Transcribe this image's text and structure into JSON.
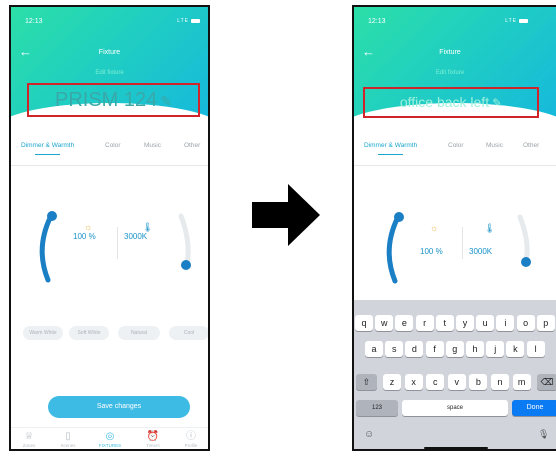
{
  "status": {
    "time": "12:13",
    "network": "LTE"
  },
  "header": {
    "title": "Fixture",
    "back": "←",
    "subtitle": "Edit fixture"
  },
  "before": {
    "name": "PRISM 124"
  },
  "after": {
    "name": "office back left"
  },
  "edit_icon": "✎",
  "tabs": [
    "Dimmer & Warmth",
    "Color",
    "Music",
    "Other"
  ],
  "dimmer": {
    "brightness": "100 %",
    "temperature": "3000K",
    "sun_icon": "☼",
    "therm_icon": "🌡"
  },
  "presets": [
    "Warm White",
    "Soft White",
    "Natural",
    "Cool"
  ],
  "save_label": "Save changes",
  "nav": [
    {
      "label": "Zones",
      "icon": "♕"
    },
    {
      "label": "Scenes",
      "icon": "▯"
    },
    {
      "label": "FIXTURES",
      "icon": "◎"
    },
    {
      "label": "Timers",
      "icon": "⏰"
    },
    {
      "label": "Profile",
      "icon": "ⓘ"
    }
  ],
  "keyboard": {
    "row1": [
      "q",
      "w",
      "e",
      "r",
      "t",
      "y",
      "u",
      "i",
      "o",
      "p"
    ],
    "row2": [
      "a",
      "s",
      "d",
      "f",
      "g",
      "h",
      "j",
      "k",
      "l"
    ],
    "row3": [
      "z",
      "x",
      "c",
      "v",
      "b",
      "n",
      "m"
    ],
    "shift": "⇧",
    "delete": "⌫",
    "num": "123",
    "space": "space",
    "done": "Done",
    "emoji": "☺",
    "mic": "🎙"
  },
  "colors": {
    "accent": "#3ebbe4",
    "highlight": "#d1232a",
    "gradient_start": "#2cdfa7",
    "gradient_end": "#16b9dc"
  }
}
